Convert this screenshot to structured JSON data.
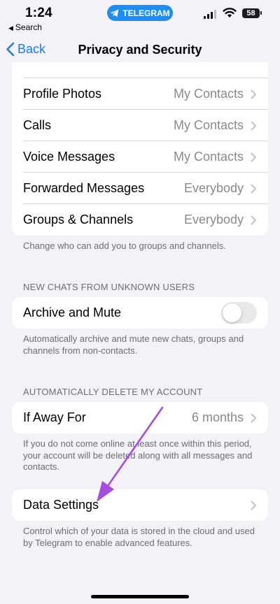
{
  "status_bar": {
    "time": "1:24",
    "back_app": "Search",
    "app_pill": "TELEGRAM",
    "battery": "58",
    "pill_color": "#1d8ef6"
  },
  "nav": {
    "back_label": "Back",
    "title": "Privacy and Security",
    "accent": "#1a7cf2"
  },
  "privacy_rows": [
    {
      "label": "Profile Photos",
      "value": "My Contacts"
    },
    {
      "label": "Calls",
      "value": "My Contacts"
    },
    {
      "label": "Voice Messages",
      "value": "My Contacts"
    },
    {
      "label": "Forwarded Messages",
      "value": "Everybody"
    },
    {
      "label": "Groups & Channels",
      "value": "Everybody"
    }
  ],
  "privacy_footer": "Change who can add you to groups and channels.",
  "new_chats": {
    "header": "NEW CHATS FROM UNKNOWN USERS",
    "row_label": "Archive and Mute",
    "toggle_on": false,
    "footer": "Automatically archive and mute new chats, groups and channels from non-contacts."
  },
  "delete_account": {
    "header": "AUTOMATICALLY DELETE MY ACCOUNT",
    "row_label": "If Away For",
    "row_value": "6 months",
    "footer": "If you do not come online at least once within this period, your account will be deleted along with all messages and contacts."
  },
  "data_settings": {
    "row_label": "Data Settings",
    "footer": "Control which of your data is stored in the cloud and used by Telegram to enable advanced features."
  },
  "annotation": {
    "arrow_color": "#a64ce0"
  }
}
